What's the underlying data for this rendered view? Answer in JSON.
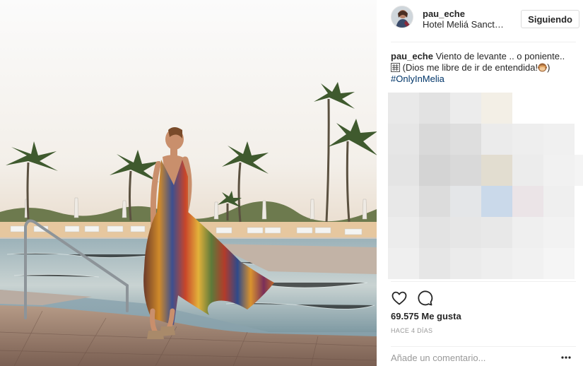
{
  "post": {
    "username": "pau_eche",
    "location": "Hotel Meliá Sancti Petri",
    "follow_label": "Siguiendo"
  },
  "caption": {
    "username": "pau_eche",
    "text_1": "Viento de levante .. o poniente..",
    "emoji_1": "dash-emoji",
    "text_2": "(Dios me libre de ir de entendida!",
    "emoji_2": "see-no-evil-monkey-emoji",
    "text_3": ")",
    "hashtag": "#OnlyInMelia"
  },
  "stats": {
    "likes": "69.575 Me gusta",
    "time": "HACE 4 DÍAS"
  },
  "comment_box": {
    "placeholder": "Añade un comentario..."
  },
  "icons": {
    "like": "heart-icon",
    "comment": "comment-icon",
    "more": "more-options-icon"
  },
  "colors": {
    "text": "#262626",
    "muted": "#999999",
    "hashtag": "#003569",
    "border": "#efefef"
  }
}
